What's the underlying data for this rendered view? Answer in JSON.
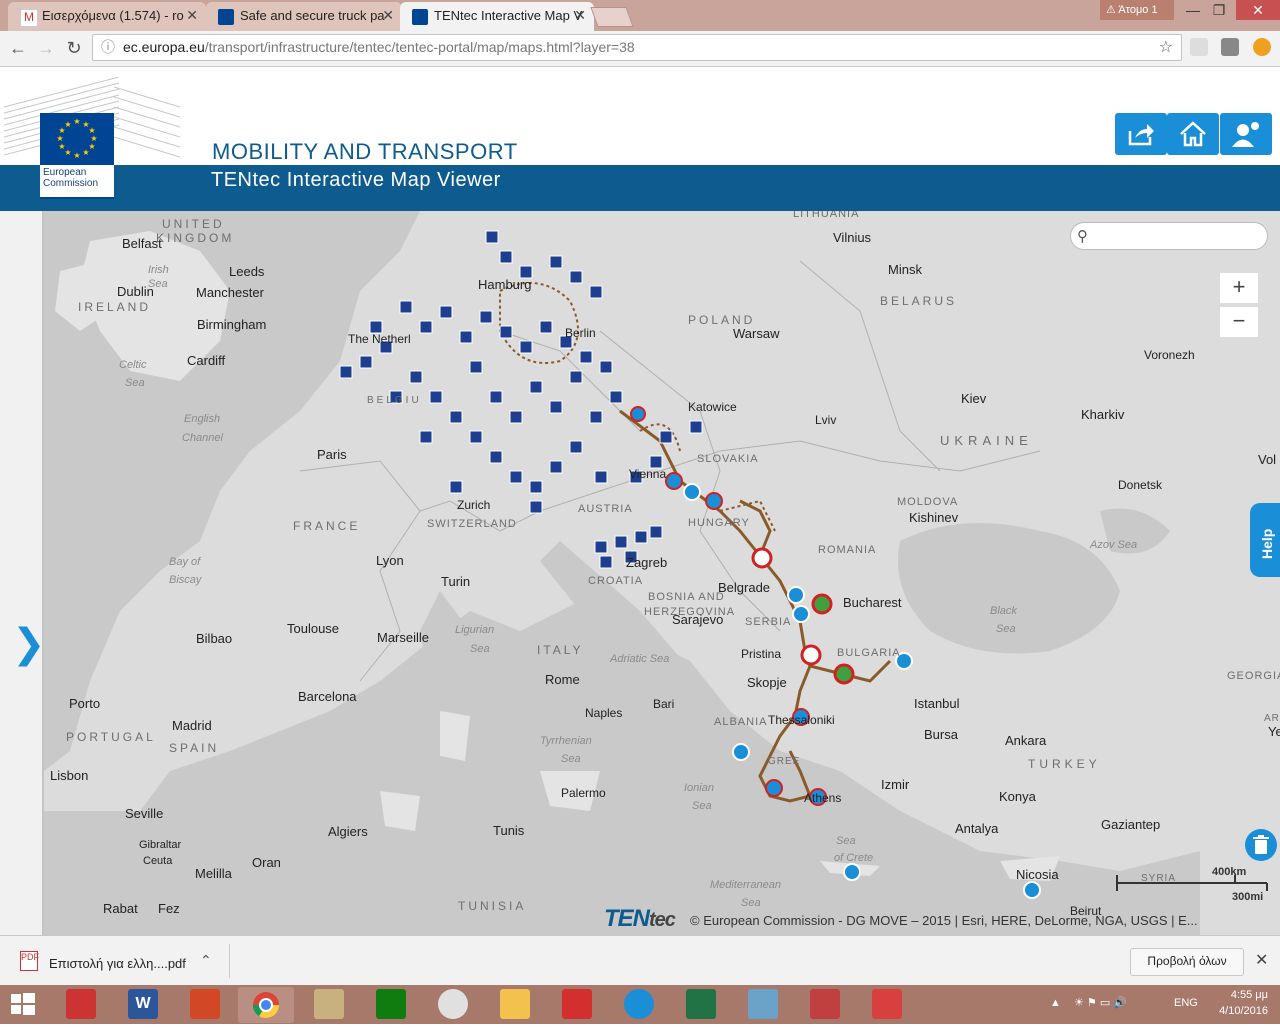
{
  "browser": {
    "tabs": [
      {
        "title": "Εισερχόμενα (1.574) - ro",
        "close": "✕"
      },
      {
        "title": "Safe and secure truck pa",
        "close": "✕"
      },
      {
        "title": "TENtec Interactive Map V",
        "close": "✕"
      }
    ],
    "profile": "Άτομο 1",
    "url_host": "ec.europa.eu",
    "url_path": "/transport/infrastructure/tentec/tentec-portal/map/maps.html?layer=38"
  },
  "header": {
    "org_line1": "European",
    "org_line2": "Commission",
    "title": "MOBILITY AND TRANSPORT",
    "subtitle": "TENtec Interactive Map Viewer"
  },
  "map": {
    "search_placeholder": "",
    "zoom_in": "+",
    "zoom_out": "−",
    "help": "Help",
    "logo_ten": "TEN",
    "logo_tec": "tec",
    "attribution": "© European Commission - DG MOVE – 2015 | Esri, HERE, DeLorme, NGA, USGS | E...",
    "scale_km": "400km",
    "scale_mi": "300mi",
    "labels": {
      "belfast": "Belfast",
      "united": "UNITED",
      "kingdom": "KINGDOM",
      "leeds": "Leeds",
      "irish": "Irish",
      "sea1": "Sea",
      "dublin": "Dublin",
      "manchester": "Manchester",
      "ireland": "IRELAND",
      "birmingham": "Birmingham",
      "celtic": "Celtic",
      "sea2": "Sea",
      "cardiff": "Cardiff",
      "english": "English",
      "channel": "Channel",
      "paris": "Paris",
      "france": "FRANCE",
      "bayof": "Bay of",
      "biscay": "Biscay",
      "lyon": "Lyon",
      "bilbao": "Bilbao",
      "toulouse": "Toulouse",
      "marseille": "Marseille",
      "porto": "Porto",
      "portugal": "PORTUGAL",
      "madrid": "Madrid",
      "spain": "SPAIN",
      "barcelona": "Barcelona",
      "lisbon": "Lisbon",
      "seville": "Seville",
      "gibraltar": "Gibraltar",
      "ceuta": "Ceuta",
      "oran": "Oran",
      "melilla": "Melilla",
      "algiers": "Algiers",
      "rabat": "Rabat",
      "fez": "Fez",
      "tunis": "Tunis",
      "tunisia": "TUNISIA",
      "hamburg": "Hamburg",
      "berlin": "Berlin",
      "thenetherlands": "The Netherl",
      "belgium": "BELGIU",
      "zurich": "Zurich",
      "switzerland": "SWITZERLAND",
      "turin": "Turin",
      "ligurian": "Ligurian",
      "sea3": "Sea",
      "italy": "ITALY",
      "rome": "Rome",
      "naples": "Naples",
      "bari": "Bari",
      "tyrrhenian": "Tyrrhenian",
      "sea4": "Sea",
      "palermo": "Palermo",
      "ionian": "Ionian",
      "sea5": "Sea",
      "austria": "AUSTRIA",
      "vienna": "Vienna",
      "zagreb": "Zagreb",
      "croatia": "CROATIA",
      "bosnia": "BOSNIA AND",
      "herzegovina": "HERZEGOVINA",
      "sarajevo": "Sarajevo",
      "adriatic": "Adriatic Sea",
      "belgrade": "Belgrade",
      "serbia": "SERBIA",
      "pristina": "Pristina",
      "skopje": "Skopje",
      "albania": "ALBANIA",
      "thessaloniki": "Thessaloniki",
      "athens": "Athens",
      "greece": "GREE",
      "hungary": "HUNGARY",
      "slovakia": "SLOVAKIA",
      "katowice": "Katowice",
      "poland": "POLAND",
      "warsaw": "Warsaw",
      "lithuania": "LITHUANIA",
      "vilnius": "Vilnius",
      "minsk": "Minsk",
      "belarus": "BELARUS",
      "lviv": "Lviv",
      "kiev": "Kiev",
      "ukraine": "UKRAINE",
      "kharkiv": "Kharkiv",
      "voronezh": "Voronezh",
      "moldova": "MOLDOVA",
      "kishinev": "Kishinev",
      "romania": "ROMANIA",
      "bucharest": "Bucharest",
      "bulgaria": "BULGARIA",
      "donetsk": "Donetsk",
      "azovsea": "Azov Sea",
      "blacksea": "Black",
      "sea6": "Sea",
      "istanbul": "Istanbul",
      "bursa": "Bursa",
      "ankara": "Ankara",
      "turkey": "TURKEY",
      "izmir": "Izmir",
      "konya": "Konya",
      "antalya": "Antalya",
      "gaziantep": "Gaziantep",
      "seaof": "Sea",
      "crete": "of Crete",
      "mediterranean": "Mediterranean",
      "sea7": "Sea",
      "nicosia": "Nicosia",
      "syria": "SYRIA",
      "beirut": "Beirut",
      "georgia": "GEORGIA",
      "vol": "Vol",
      "ye": "Ye",
      "ar": "AR"
    }
  },
  "download": {
    "file": "Επιστολή για ελλη....pdf",
    "show_all": "Προβολή όλων",
    "close": "✕"
  },
  "taskbar": {
    "lang": "ENG",
    "time": "4:55 μμ",
    "date": "4/10/2016"
  },
  "colors": {
    "eu_blue": "#004494",
    "header_bar": "#0d5b8f",
    "accent": "#1a8fd8",
    "route": "#8b5a2b",
    "parking": "#1e3f8f"
  }
}
